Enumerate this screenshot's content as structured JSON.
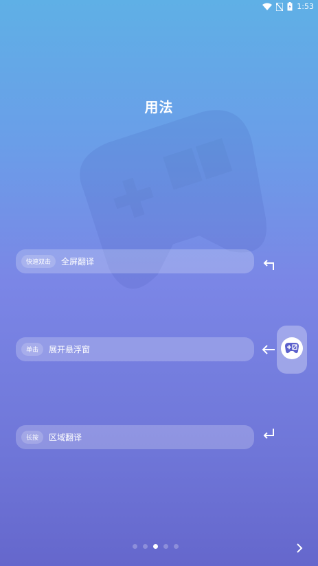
{
  "status": {
    "time": "1:53"
  },
  "title": "用法",
  "rows": [
    {
      "badge": "快速双击",
      "label": "全屏翻译"
    },
    {
      "badge": "单击",
      "label": "展开悬浮窗"
    },
    {
      "badge": "长按",
      "label": "区域翻译"
    }
  ],
  "pager": {
    "count": 5,
    "active_index": 2
  },
  "colors": {
    "bg_top": "#5fb0e6",
    "bg_bottom": "#6567cc",
    "icon_accent": "#5b60cc"
  },
  "icons": {
    "wifi": "wifi-icon",
    "sim": "no-sim-icon",
    "battery": "battery-charging-icon",
    "float": "gamepad-translate-icon",
    "next": "chevron-right-icon"
  }
}
